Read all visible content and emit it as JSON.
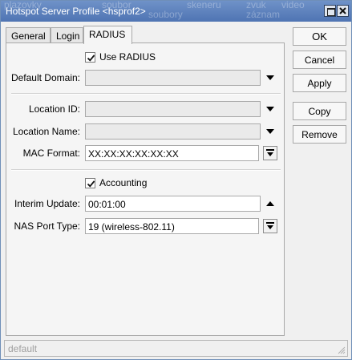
{
  "window": {
    "title": "Hotspot Server Profile <hsprof2>",
    "background_text": [
      "plazovky",
      "soubor",
      "soubory",
      "skeneru",
      "zvuk",
      "záznam",
      "video"
    ]
  },
  "tabs": [
    {
      "label": "General",
      "active": false
    },
    {
      "label": "Login",
      "active": false
    },
    {
      "label": "RADIUS",
      "active": true
    }
  ],
  "radius": {
    "use_radius": {
      "label": "Use RADIUS",
      "checked": true
    },
    "default_domain": {
      "label": "Default Domain:",
      "value": "",
      "enabled": false
    },
    "location_id": {
      "label": "Location ID:",
      "value": "",
      "enabled": false
    },
    "location_name": {
      "label": "Location Name:",
      "value": "",
      "enabled": false
    },
    "mac_format": {
      "label": "MAC Format:",
      "value": "XX:XX:XX:XX:XX:XX"
    },
    "accounting": {
      "label": "Accounting",
      "checked": true
    },
    "interim_update": {
      "label": "Interim Update:",
      "value": "00:01:00"
    },
    "nas_port_type": {
      "label": "NAS Port Type:",
      "value": "19 (wireless-802.11)"
    }
  },
  "buttons": {
    "ok": "OK",
    "cancel": "Cancel",
    "apply": "Apply",
    "copy": "Copy",
    "remove": "Remove"
  },
  "status": {
    "text": "default"
  },
  "icons": {
    "restore": "restore-icon",
    "close": "close-icon",
    "dropdown": "dropdown-arrow-icon",
    "spin_up": "up-arrow-icon",
    "checkbox": "checkmark-icon",
    "resize": "resize-grip-icon"
  },
  "colors": {
    "titlebar": "#5a7fbd",
    "panel": "#f5f5f5",
    "disabled_field": "#eaeaea"
  }
}
